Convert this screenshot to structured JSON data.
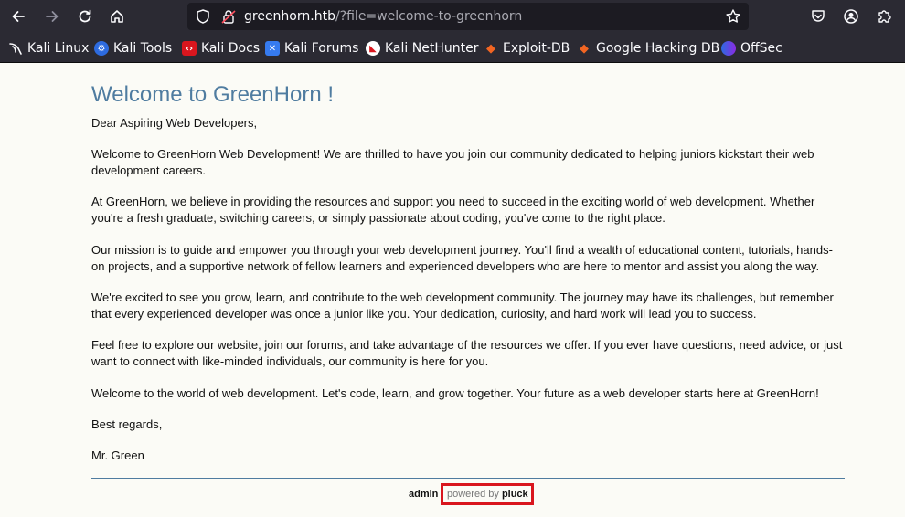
{
  "browser": {
    "url_host": "greenhorn.htb",
    "url_path": "/?file=welcome-to-greenhorn",
    "bookmarks": [
      {
        "label": "Kali Linux",
        "icon": "kali-dragon-icon"
      },
      {
        "label": "Kali Tools",
        "icon": "kali-tools-icon"
      },
      {
        "label": "Kali Docs",
        "icon": "kali-docs-icon"
      },
      {
        "label": "Kali Forums",
        "icon": "kali-forums-icon"
      },
      {
        "label": "Kali NetHunter",
        "icon": "kali-nethunter-icon"
      },
      {
        "label": "Exploit-DB",
        "icon": "exploit-db-icon"
      },
      {
        "label": "Google Hacking DB",
        "icon": "ghdb-icon"
      },
      {
        "label": "OffSec",
        "icon": "offsec-icon"
      }
    ],
    "colors": {
      "chrome_bg": "#2b2a33",
      "urlbar_bg": "#1c1b22"
    }
  },
  "page": {
    "title": "Welcome to GreenHorn !",
    "paragraphs": [
      "Dear Aspiring Web Developers,",
      "Welcome to GreenHorn Web Development! We are thrilled to have you join our community dedicated to helping juniors kickstart their web development careers.",
      "At GreenHorn, we believe in providing the resources and support you need to succeed in the exciting world of web development. Whether you're a fresh graduate, switching careers, or simply passionate about coding, you've come to the right place.",
      "Our mission is to guide and empower you through your web development journey. You'll find a wealth of educational content, tutorials, hands-on projects, and a supportive network of fellow learners and experienced developers who are here to mentor and assist you along the way.",
      "We're excited to see you grow, learn, and contribute to the web development community. The journey may have its challenges, but remember that every experienced developer was once a junior like you. Your dedication, curiosity, and hard work will lead you to success.",
      "Feel free to explore our website, join our forums, and take advantage of the resources we offer. If you ever have questions, need advice, or just want to connect with like-minded individuals, our community is here for you.",
      "Welcome to the world of web development. Let's code, learn, and grow together. Your future as a web developer starts here at GreenHorn!",
      "Best regards,",
      "Mr. Green"
    ],
    "title_color": "#4f7ca0",
    "background": "#fbfbf6"
  },
  "footer": {
    "admin_label": "admin",
    "powered_prefix": "powered by",
    "powered_brand": "pluck",
    "highlight_color": "#d9161e"
  }
}
